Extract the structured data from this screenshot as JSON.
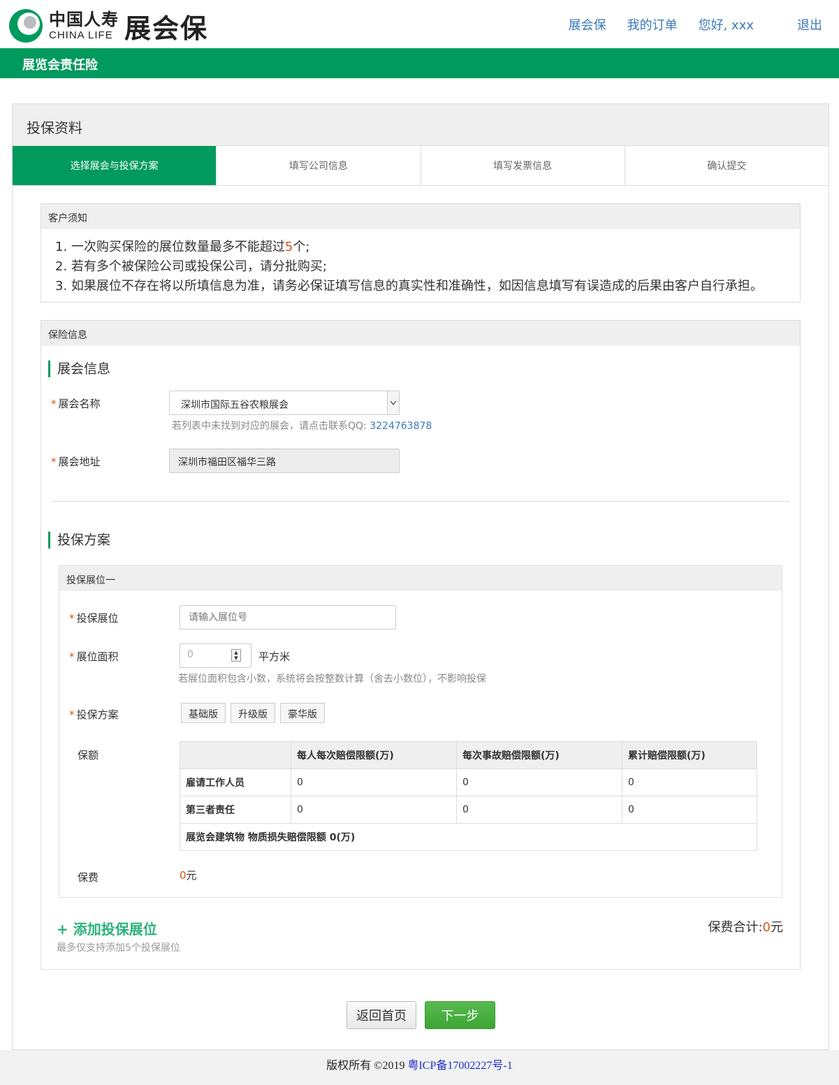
{
  "brand": {
    "cn": "中国人寿",
    "en": "CHINA LIFE",
    "product": "展会保",
    "color": "#009a5e"
  },
  "nav": {
    "item1": "展会保",
    "item2": "我的订单",
    "greeting": "您好, xxx",
    "logout": "退出"
  },
  "banner": "展览会责任险",
  "panel": {
    "title": "投保资料",
    "steps": [
      "选择展会与投保方案",
      "填写公司信息",
      "填写发票信息",
      "确认提交"
    ]
  },
  "notice": {
    "title": "客户须知",
    "line1_pre": "1. 一次购买保险的展位数量最多不能超过",
    "line1_num": "5",
    "line1_post": "个;",
    "line2": "2. 若有多个被保险公司或投保公司，请分批购买;",
    "line3": "3. 如果展位不存在将以所填信息为准，请务必保证填写信息的真实性和准确性，如因信息填写有误造成的后果由客户自行承担。"
  },
  "insurance": {
    "title": "保险信息",
    "exhibition_section": "展会信息",
    "name_label": "展会名称",
    "name_value": "深圳市国际五谷农粮展会",
    "name_hint": "若列表中未找到对应的展会，请点击联系QQ:",
    "qq": "3224763878",
    "address_label": "展会地址",
    "address_value": "深圳市福田区福华三路",
    "plan_section": "投保方案"
  },
  "booth": {
    "title": "投保展位一",
    "booth_label": "投保展位",
    "booth_placeholder": "请输入展位号",
    "area_label": "展位面积",
    "area_value": "0",
    "area_unit": "平方米",
    "area_hint": "若展位面积包含小数，系统将会按整数计算（舍去小数位），不影响投保",
    "plan_label": "投保方案",
    "plans": [
      "基础版",
      "升级版",
      "豪华版"
    ],
    "coverage_label": "保额",
    "coverage": {
      "headers": [
        "",
        "每人每次赔偿限额(万)",
        "每次事故赔偿限额(万)",
        "累计赔偿限额(万)"
      ],
      "rows": [
        {
          "name": "雇请工作人员",
          "v1": "0",
          "v2": "0",
          "v3": "0"
        },
        {
          "name": "第三者责任",
          "v1": "0",
          "v2": "0",
          "v3": "0"
        }
      ],
      "building": "展览会建筑物 物质损失赔偿限额 0(万)"
    },
    "fee_label": "保费",
    "fee_value": "0",
    "fee_unit": "元"
  },
  "add": {
    "label": "+ 添加投保展位",
    "hint": "最多仅支持添加5个投保展位"
  },
  "total": {
    "label": "保费合计:",
    "value": "0",
    "unit": "元"
  },
  "buttons": {
    "back": "返回首页",
    "next": "下一步"
  },
  "footer": {
    "copyright": "版权所有 ©2019",
    "icp": "粤ICP备17002227号-1"
  }
}
